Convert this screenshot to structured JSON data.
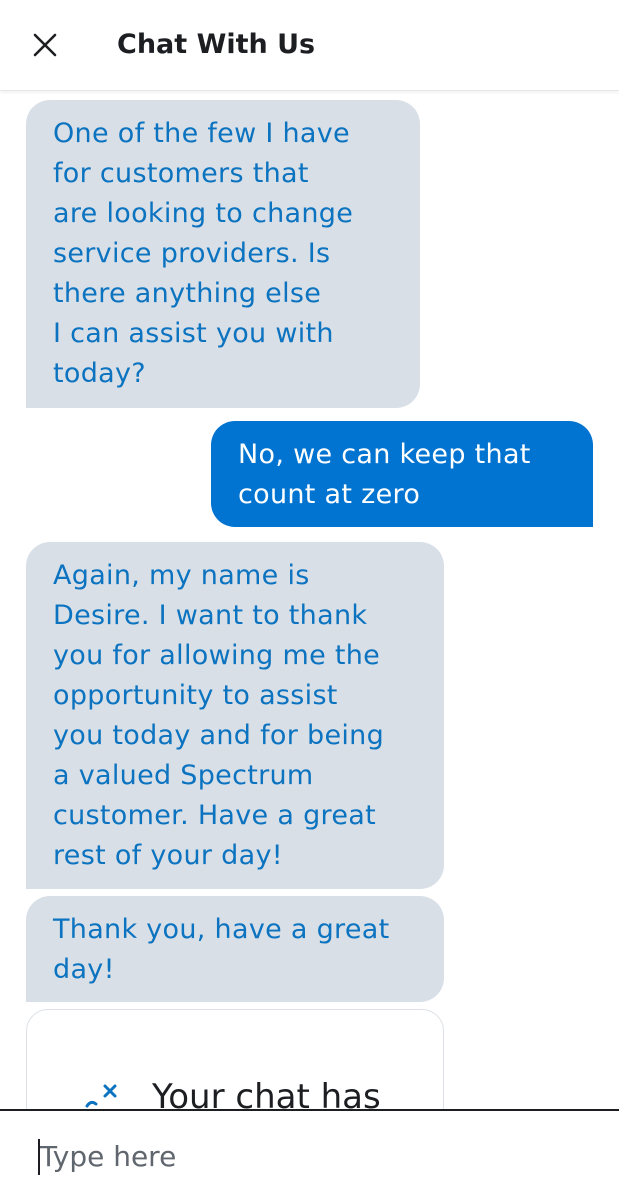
{
  "header": {
    "title": "Chat With Us",
    "close_icon": "close-icon"
  },
  "messages": [
    {
      "sender": "agent",
      "lines": [
        "One of the few I have",
        "for customers that",
        "are looking to change",
        "service providers. Is",
        "there anything else",
        "I can assist you with",
        "today?"
      ]
    },
    {
      "sender": "user",
      "lines": [
        "No, we can keep that",
        "count at zero"
      ]
    },
    {
      "sender": "agent",
      "lines": [
        "Again, my name is",
        "Desire. I want to thank",
        "you for allowing me the",
        "opportunity to assist",
        "you today and for being",
        "a valued Spectrum",
        "customer. Have a great",
        "rest of your day!"
      ]
    },
    {
      "sender": "agent",
      "lines": [
        "Thank you, have a great",
        "day!"
      ]
    }
  ],
  "chat_ended": {
    "text": "Your chat has",
    "icon": "chat-ended-icon"
  },
  "input": {
    "placeholder": "Type here",
    "value": ""
  },
  "colors": {
    "agent_bubble_bg": "#d9dfe7",
    "agent_text": "#0b73bf",
    "user_bubble_bg": "#0173d0",
    "user_text": "#ffffff"
  }
}
